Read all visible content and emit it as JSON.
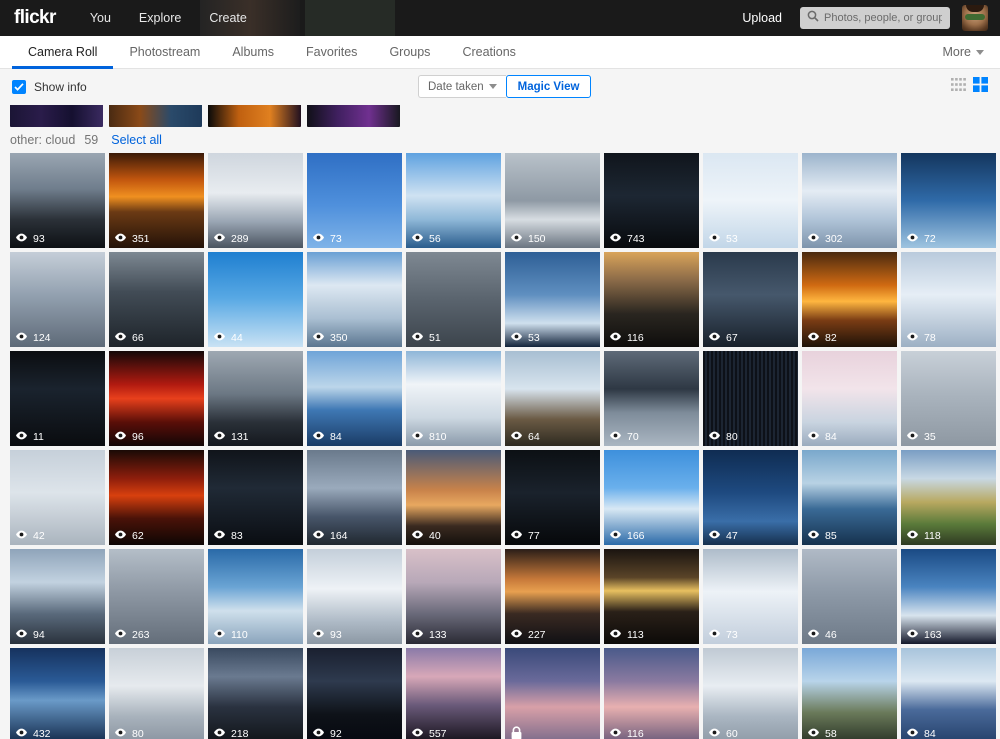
{
  "header": {
    "logo": "flickr",
    "nav": [
      {
        "label": "You"
      },
      {
        "label": "Explore"
      },
      {
        "label": "Create"
      }
    ],
    "upload_label": "Upload",
    "search": {
      "placeholder": "Photos, people, or groups",
      "value": ""
    },
    "search_icon": "search-icon",
    "avatar_icon": "user-avatar"
  },
  "tabs": {
    "items": [
      {
        "label": "Camera Roll",
        "active": true
      },
      {
        "label": "Photostream",
        "active": false
      },
      {
        "label": "Albums",
        "active": false
      },
      {
        "label": "Favorites",
        "active": false
      },
      {
        "label": "Groups",
        "active": false
      },
      {
        "label": "Creations",
        "active": false
      }
    ],
    "more_label": "More",
    "active_color": "#0063dc"
  },
  "toolbar": {
    "show_info_label": "Show info",
    "show_info_checked": true,
    "sort_label": "Date taken",
    "magic_view_label": "Magic View",
    "view_small_icon": "grid-small-icon",
    "view_large_icon": "grid-large-icon",
    "accent_color": "#0084ff",
    "link_color": "#0063dc"
  },
  "section": {
    "title": "other: cloud",
    "count": "59",
    "select_all_label": "Select all"
  },
  "strip": [
    {
      "colors": [
        "#1b1535",
        "#2a1c4a",
        "#151030",
        "#3a2a60"
      ]
    },
    {
      "colors": [
        "#4a2a12",
        "#8a4a18",
        "#2a4a6a",
        "#1e3a5a"
      ]
    },
    {
      "colors": [
        "#0a0a0a",
        "#c06010",
        "#e08020",
        "#201020"
      ]
    },
    {
      "colors": [
        "#101018",
        "#402060",
        "#703090",
        "#181820"
      ]
    }
  ],
  "photos": [
    {
      "views": "93",
      "private": false,
      "sky": "storm-dark"
    },
    {
      "views": "351",
      "private": false,
      "sky": "sunset-fire"
    },
    {
      "views": "289",
      "private": false,
      "sky": "cumulus-gray"
    },
    {
      "views": "73",
      "private": false,
      "sky": "blue-wisp"
    },
    {
      "views": "56",
      "private": false,
      "sky": "cumulus-blue"
    },
    {
      "views": "150",
      "private": false,
      "sky": "wing-haze"
    },
    {
      "views": "743",
      "private": false,
      "sky": "night-dark"
    },
    {
      "views": "53",
      "private": false,
      "sky": "pale-blue"
    },
    {
      "views": "302",
      "private": false,
      "sky": "mackerel"
    },
    {
      "views": "72",
      "private": false,
      "sky": "deep-blue"
    },
    {
      "views": "124",
      "private": false,
      "sky": "gray-overcast"
    },
    {
      "views": "66",
      "private": false,
      "sky": "dark-cumulus"
    },
    {
      "views": "44",
      "private": false,
      "sky": "bright-blue"
    },
    {
      "views": "350",
      "private": false,
      "sky": "tower-cloud"
    },
    {
      "views": "51",
      "private": false,
      "sky": "gray-flat"
    },
    {
      "views": "53",
      "private": false,
      "sky": "wing-blue"
    },
    {
      "views": "116",
      "private": false,
      "sky": "dusk-field"
    },
    {
      "views": "67",
      "private": false,
      "sky": "dark-sea"
    },
    {
      "views": "82",
      "private": false,
      "sky": "sun-orange"
    },
    {
      "views": "78",
      "private": false,
      "sky": "pale-cloud"
    },
    {
      "views": "11",
      "private": false,
      "sky": "night-streak"
    },
    {
      "views": "96",
      "private": false,
      "sky": "red-glow"
    },
    {
      "views": "131",
      "private": false,
      "sky": "city-haze"
    },
    {
      "views": "84",
      "private": false,
      "sky": "aerial-blue"
    },
    {
      "views": "810",
      "private": false,
      "sky": "big-cumulus"
    },
    {
      "views": "64",
      "private": false,
      "sky": "tree-sky"
    },
    {
      "views": "70",
      "private": false,
      "sky": "dark-clouds"
    },
    {
      "views": "80",
      "private": false,
      "sky": "striped-dark"
    },
    {
      "views": "84",
      "private": false,
      "sky": "pink-pale"
    },
    {
      "views": "35",
      "private": false,
      "sky": "soft-gray"
    },
    {
      "views": "42",
      "private": false,
      "sky": "pole-sky"
    },
    {
      "views": "62",
      "private": false,
      "sky": "red-sunset"
    },
    {
      "views": "83",
      "private": false,
      "sky": "lightning"
    },
    {
      "views": "164",
      "private": false,
      "sky": "mast-cloud"
    },
    {
      "views": "40",
      "private": false,
      "sky": "orange-dusk"
    },
    {
      "views": "77",
      "private": false,
      "sky": "dark-night"
    },
    {
      "views": "166",
      "private": false,
      "sky": "wing-bright"
    },
    {
      "views": "47",
      "private": false,
      "sky": "sea-blue"
    },
    {
      "views": "85",
      "private": false,
      "sky": "horizon-blue"
    },
    {
      "views": "118",
      "private": false,
      "sky": "rainbow"
    },
    {
      "views": "94",
      "private": false,
      "sky": "road-sky"
    },
    {
      "views": "263",
      "private": false,
      "sky": "smooth-gray"
    },
    {
      "views": "110",
      "private": false,
      "sky": "aerial-ocean"
    },
    {
      "views": "93",
      "private": false,
      "sky": "halo-cloud"
    },
    {
      "views": "133",
      "private": false,
      "sky": "harbor-dusk"
    },
    {
      "views": "227",
      "private": false,
      "sky": "lake-sunset"
    },
    {
      "views": "113",
      "private": false,
      "sky": "sun-field"
    },
    {
      "views": "73",
      "private": false,
      "sky": "white-cloud"
    },
    {
      "views": "46",
      "private": false,
      "sky": "gray-cloud"
    },
    {
      "views": "163",
      "private": false,
      "sky": "contrail"
    },
    {
      "views": "432",
      "private": false,
      "sky": "sun-burst"
    },
    {
      "views": "80",
      "private": false,
      "sky": "altocumulus"
    },
    {
      "views": "218",
      "private": false,
      "sky": "dusk-trees"
    },
    {
      "views": "92",
      "private": false,
      "sky": "road-night"
    },
    {
      "views": "557",
      "private": false,
      "sky": "pier-sunset"
    },
    {
      "views": "",
      "private": true,
      "sky": "pink-blur"
    },
    {
      "views": "116",
      "private": false,
      "sky": "pink-blur2"
    },
    {
      "views": "60",
      "private": false,
      "sky": "mackerel2"
    },
    {
      "views": "58",
      "private": false,
      "sky": "tree-blue"
    },
    {
      "views": "84",
      "private": false,
      "sky": "wing-cloud"
    }
  ]
}
